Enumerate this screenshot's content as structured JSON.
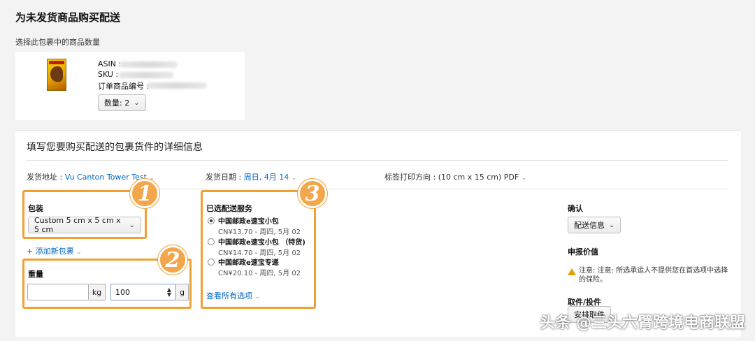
{
  "page": {
    "title": "为未发货商品购买配送",
    "subtitle": "选择此包裹中的商品数量"
  },
  "item": {
    "asin_label": "ASIN :",
    "sku_label": "SKU :",
    "order_item_label": "订单商品编号 :",
    "quantity_label": "数量: 2"
  },
  "details": {
    "heading": "填写您要购买配送的包裹货件的详细信息",
    "ship_from_label": "发货地址 :",
    "ship_from_value": "Vu Canton Tower Test",
    "ship_date_label": "发货日期 :",
    "ship_date_value": "周日, 4月 14",
    "label_orientation_label": "标签打印方向 :",
    "label_orientation_value": "(10 cm x 15 cm) PDF"
  },
  "package": {
    "badge": "1",
    "label": "包装",
    "selected": "Custom 5 cm x 5 cm x 5 cm",
    "add_new": "+ 添加新包裹"
  },
  "weight": {
    "badge": "2",
    "label": "重量",
    "kg_value": "",
    "kg_unit": "kg",
    "g_value": "100",
    "g_unit": "g"
  },
  "services": {
    "badge": "3",
    "label": "已选配送服务",
    "options": [
      {
        "name": "中国邮政e速宝小包",
        "price": "CN¥13.70 - 周四, 5月 02",
        "selected": true
      },
      {
        "name": "中国邮政e速宝小包 （特货)",
        "price": "CN¥14.70 - 周四, 5月 02",
        "selected": false
      },
      {
        "name": "中国邮政e速宝专递",
        "price": "CN¥20.10 - 周四, 5月 02",
        "selected": false
      }
    ],
    "see_all": "查看所有选项"
  },
  "confirm": {
    "label": "确认",
    "delivery_info_button": "配送信息",
    "declared_value_label": "申报价值",
    "notice": "注意: 注意: 所选承运人不提供您在首选项中选择的保险。",
    "pickup_label": "取件/投件",
    "pickup_button": "安排取件"
  },
  "watermark": "头条 @三头六臂跨境电商联盟",
  "colors": {
    "accent_orange": "#f0a033",
    "link_blue": "#0066c0",
    "warning": "#e3a000"
  }
}
